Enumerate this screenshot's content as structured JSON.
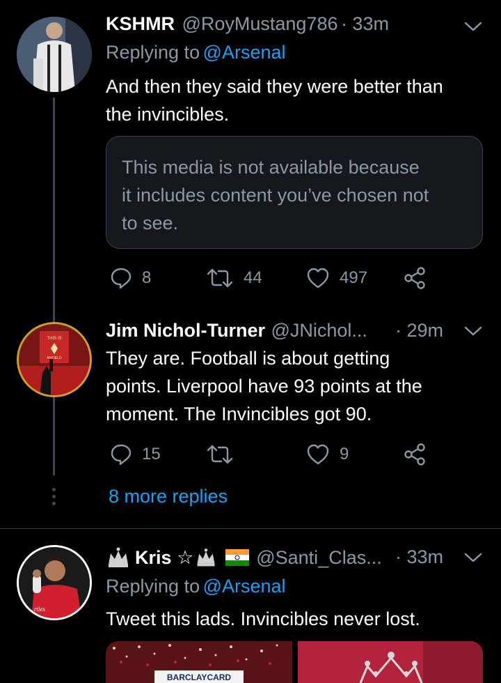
{
  "tweet1": {
    "display_name": "KSHMR",
    "handle": "@RoyMustang786",
    "time": "· 33m",
    "replying_label": "Replying to",
    "replying_handle": "@Arsenal",
    "text_line1": "And then they said they were better than",
    "text_line2": "the invincibles.",
    "media_notice_line1": "This media is not available because",
    "media_notice_line2": "it includes content you’ve chosen not",
    "media_notice_line3": "to see.",
    "replies": "8",
    "retweets": "44",
    "likes": "497"
  },
  "tweet2": {
    "display_name": "Jim Nichol-Turner",
    "handle": "@JNichol...",
    "time": "· 29m",
    "text_line1": "They are. Football is about getting",
    "text_line2": "points. Liverpool have 93 points at the",
    "text_line3": "moment. The Invincibles got 90.",
    "replies": "15",
    "likes": "9",
    "avatar_sign_top": "THIS IS",
    "avatar_sign_bottom": "ANFIELD"
  },
  "more_replies": "8 more replies",
  "tweet3": {
    "display_name": "Kris ☆",
    "handle": "@Santi_Clas...",
    "time": "· 33m",
    "replying_label": "Replying to",
    "replying_handle": "@Arsenal",
    "text": "Tweet this lads. Invincibles never lost.",
    "media_caption": "BARCLAYCARD"
  },
  "icons": [
    "chevron-down-icon",
    "reply-icon",
    "retweet-icon",
    "like-icon",
    "share-icon",
    "more-dots-icon",
    "crown-icon",
    "flag-india-icon"
  ],
  "colors": {
    "accent": "#1da1f2",
    "muted": "#8b98a5",
    "background": "#000000",
    "line": "#3d4650"
  }
}
